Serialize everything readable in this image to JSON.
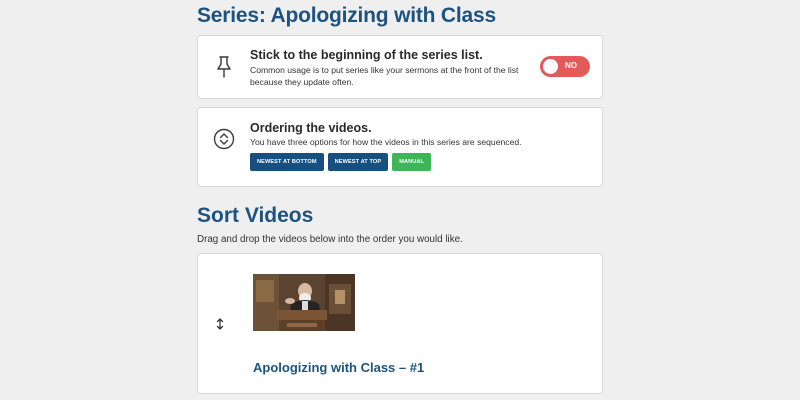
{
  "page": {
    "title": "Series: Apologizing with Class"
  },
  "stick_setting": {
    "heading": "Stick to the beginning of the series list.",
    "description": "Common usage is to put series like your sermons at the front of the list because they update often.",
    "icon": "pin-icon",
    "toggle": {
      "label": "NO",
      "state": "off",
      "color": "#e45a5a"
    }
  },
  "ordering": {
    "heading": "Ordering the videos.",
    "description": "You have three options for how the videos in this series are sequenced.",
    "icon": "sort-arrows-icon",
    "buttons": [
      {
        "label": "NEWEST AT BOTTOM",
        "color": "#17507f"
      },
      {
        "label": "NEWEST AT TOP",
        "color": "#17507f"
      },
      {
        "label": "MANUAL",
        "color": "#3fb55a",
        "selected": true
      }
    ]
  },
  "sort_videos": {
    "title": "Sort Videos",
    "description": "Drag and drop the videos below into the order you would like.",
    "items": [
      {
        "title": "Apologizing with Class – #1",
        "handle_icon": "drag-vertical-arrows-icon",
        "thumbnail": "sermon-speaker-thumbnail"
      }
    ]
  },
  "colors": {
    "heading_blue": "#1e5381",
    "page_background": "#efefef"
  }
}
